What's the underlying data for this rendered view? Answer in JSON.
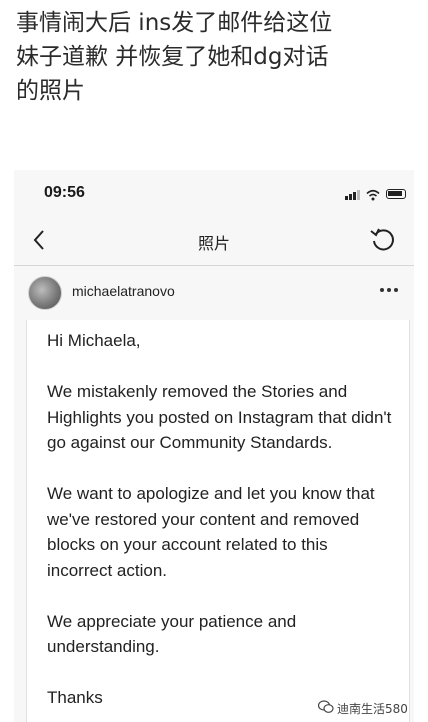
{
  "caption": {
    "line1": "事情闹大后 ins发了邮件给这位",
    "line2": "妹子道歉 并恢复了她和dg对话",
    "line3": "的照片"
  },
  "status_bar": {
    "time": "09:56",
    "icons": [
      "signal-icon",
      "wifi-icon",
      "battery-icon"
    ]
  },
  "nav": {
    "title": "照片",
    "back_icon": "chevron-left-icon",
    "refresh_icon": "refresh-icon"
  },
  "post": {
    "username": "michaelatranovo",
    "more_icon": "more-horizontal-icon"
  },
  "email": {
    "greeting": "Hi Michaela,",
    "paragraph1": "We mistakenly removed the Stories and Highlights you posted on Instagram that didn't go against our Community Standards.",
    "paragraph2": "We want to apologize and let you know that we've restored your content and removed blocks on your account related to this incorrect action.",
    "paragraph3": "We appreciate your patience and understanding.",
    "closing": "Thanks"
  },
  "watermarks": {
    "right": "迪南生活580"
  },
  "colors": {
    "background": "#ffffff",
    "phone_background": "#f7f7f7",
    "text": "#222222"
  }
}
